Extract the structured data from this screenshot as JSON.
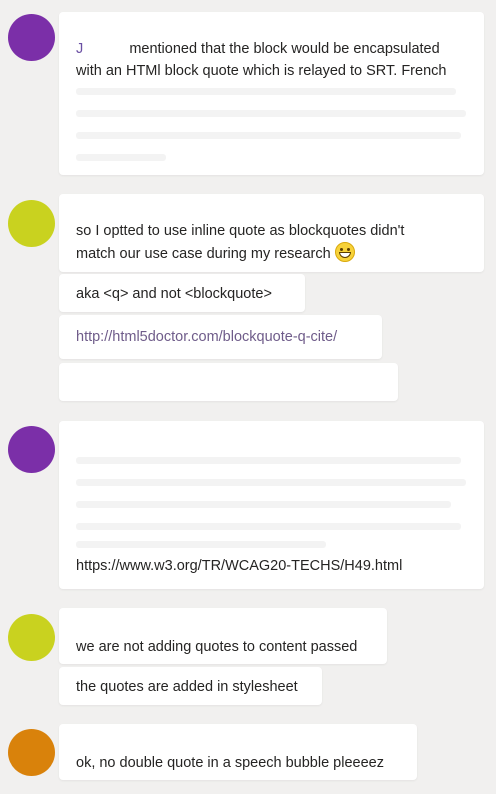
{
  "avatar_colors": {
    "purple": "#7b2fa8",
    "lime": "#c9d21f",
    "orange": "#d9820b"
  },
  "messages": [
    {
      "sender_initial": "J",
      "text_line1": "mentioned that the block would be encapsulated",
      "text_line2": "with an HTMl block quote which is relayed to SRT. French"
    },
    {
      "line1": "so I optted to use inline quote as blockquotes didn't",
      "line2": "match our use case during my research",
      "emoji": "grinning-face-icon"
    },
    {
      "text": "aka <q> and not <blockquote>"
    },
    {
      "link": "http://html5doctor.com/blockquote-q-cite/"
    },
    {
      "link": "https://www.w3.org/TR/WCAG20-TECHS/H49.html"
    },
    {
      "text": "we are not adding quotes to content passed"
    },
    {
      "text": "the quotes are added in stylesheet"
    },
    {
      "text": "ok, no double quote in a speech bubble pleeeez"
    }
  ]
}
